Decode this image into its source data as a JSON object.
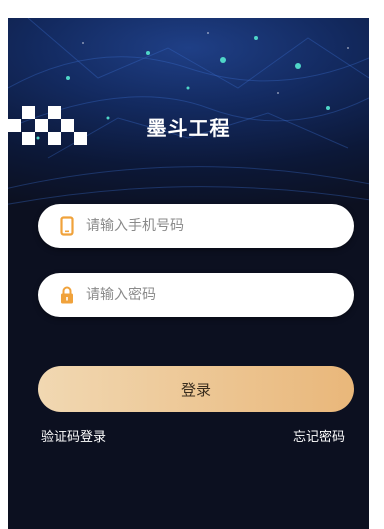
{
  "brand": {
    "name": "墨斗工程",
    "logo_icon": "checkered-logo-icon"
  },
  "form": {
    "phone": {
      "placeholder": "请输入手机号码",
      "value": "",
      "icon": "phone-icon",
      "icon_color": "#f0a23b"
    },
    "password": {
      "placeholder": "请输入密码",
      "value": "",
      "icon": "lock-icon",
      "icon_color": "#f0a23b"
    }
  },
  "actions": {
    "login_label": "登录",
    "sms_login_label": "验证码登录",
    "forgot_password_label": "忘记密码"
  },
  "theme": {
    "background": "#0c1020",
    "hero_blue": "#1f3f86",
    "button_gradient_start": "#f1d8b2",
    "button_gradient_end": "#e9b77a",
    "accent_orange": "#f0a23b"
  }
}
